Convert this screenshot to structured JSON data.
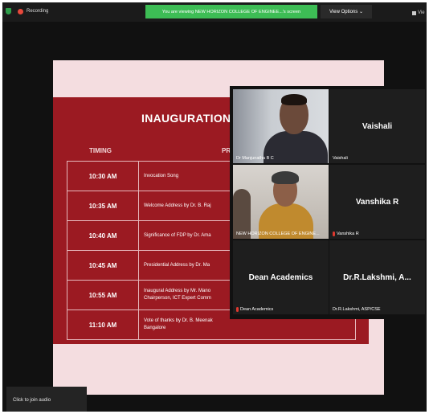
{
  "topbar": {
    "recording_label": "Recording",
    "banner_text": "You are viewing NEW HORIZON COLLEGE OF ENGINEE...'s screen",
    "view_options_label": "View Options ⌄",
    "view_label": "Vie"
  },
  "slide": {
    "title": "INAUGURATION",
    "header_timing": "TIMING",
    "header_program": "PR",
    "rows": [
      {
        "time": "10:30 AM",
        "desc": "Invocation Song"
      },
      {
        "time": "10:35 AM",
        "desc": "Welcome Address by Dr. B. Raj"
      },
      {
        "time": "10:40 AM",
        "desc": "Significance of FDP by Dr. Ama"
      },
      {
        "time": "10:45 AM",
        "desc": "Presidential Address by Dr. Ma"
      },
      {
        "time": "10:55 AM",
        "desc": "Inaugural Address by Mr. Mano\nChairperson, ICT Expert Comm"
      },
      {
        "time": "11:10 AM",
        "desc": "Vote of thanks by Dr. B. Meenak\nBangalore"
      }
    ]
  },
  "participants": [
    {
      "name": "Dr Manjunatha B C",
      "big": "",
      "muted": false,
      "video": "1"
    },
    {
      "name": "Vaishali",
      "big": "Vaishali",
      "muted": false,
      "video": ""
    },
    {
      "name": "NEW HORIZON COLLEGE OF ENGINE...",
      "big": "",
      "muted": false,
      "video": "2"
    },
    {
      "name": "Vanshika R",
      "big": "Vanshika R",
      "muted": true,
      "video": ""
    },
    {
      "name": "Dean Academics",
      "big": "Dean Academics",
      "muted": true,
      "video": ""
    },
    {
      "name": "Dr.R.Lakshmi, ASP/CSE",
      "big": "Dr.R.Lakshmi,  A...",
      "muted": false,
      "video": ""
    }
  ],
  "footer": {
    "join_audio_label": "Click to join audio"
  },
  "colors": {
    "banner": "#3dbd55",
    "slide_maroon": "#9b1a22",
    "active_speaker": "#c9c23a",
    "mute": "#e0392f"
  }
}
